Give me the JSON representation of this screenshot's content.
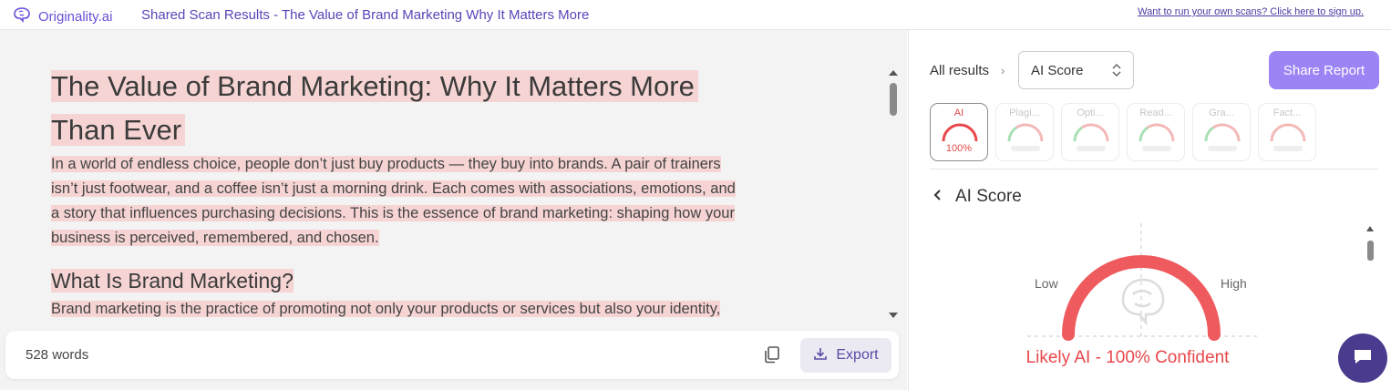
{
  "header": {
    "brand": "Originality.ai",
    "title": "Shared Scan Results - The Value of Brand Marketing Why It Matters More",
    "signup_link": "Want to run your own scans? Click here to sign up."
  },
  "document": {
    "heading_line1": "The Value of Brand Marketing: Why It Matters More",
    "heading_line2": "Than Ever",
    "para1_lines": [
      "In a world of endless choice, people don’t just buy products — they buy into brands. A pair of trainers",
      "isn’t just footwear, and a coffee isn’t just a morning drink. Each comes with associations, emotions, and",
      "a story that influences purchasing decisions. This is the essence of brand marketing: shaping how your",
      "business is perceived, remembered, and chosen."
    ],
    "subheading": "What Is Brand Marketing?",
    "para2_line1": "Brand marketing is the practice of promoting not only your products or services but also your identity,",
    "highlight_color": "#f5d4d3"
  },
  "footer": {
    "word_count": "528 words",
    "export_label": "Export"
  },
  "results": {
    "breadcrumb": "All results",
    "select_value": "AI Score",
    "share_label": "Share Report",
    "tabs": [
      {
        "label": "AI",
        "value": "100%",
        "active": true
      },
      {
        "label": "Plagi...",
        "value": "",
        "active": false
      },
      {
        "label": "Opti...",
        "value": "",
        "active": false
      },
      {
        "label": "Read...",
        "value": "",
        "active": false
      },
      {
        "label": "Gra...",
        "value": "",
        "active": false
      },
      {
        "label": "Fact...",
        "value": "",
        "active": false
      }
    ],
    "section_title": "AI Score",
    "gauge_low": "Low",
    "gauge_high": "High",
    "gauge_fraction": 1.0,
    "verdict": "Likely AI - 100% Confident",
    "accent_color": "#e8484b"
  }
}
